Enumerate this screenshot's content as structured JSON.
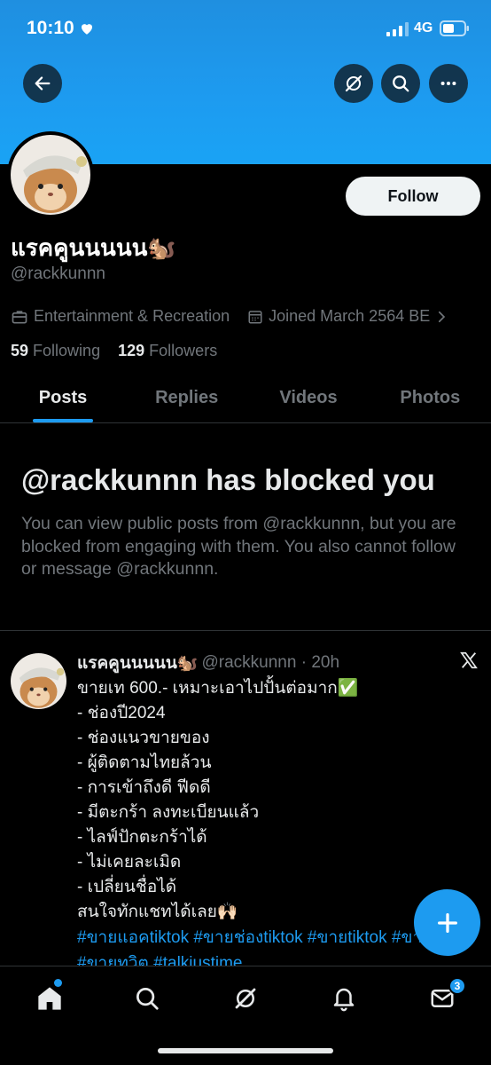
{
  "status": {
    "time": "10:10",
    "network": "4G"
  },
  "header": {
    "icons": [
      "back-arrow-icon",
      "grok-icon",
      "search-icon",
      "more-icon"
    ],
    "banner_color": "#1d9bf0"
  },
  "profile": {
    "display_name": "แรคคูนนนนน🐿️",
    "handle": "@rackkunnn",
    "follow_label": "Follow",
    "category": "Entertainment & Recreation",
    "joined": "Joined March 2564 BE",
    "following_count": "59",
    "following_label": "Following",
    "followers_count": "129",
    "followers_label": "Followers"
  },
  "tabs": [
    {
      "label": "Posts",
      "active": true
    },
    {
      "label": "Replies",
      "active": false
    },
    {
      "label": "Videos",
      "active": false
    },
    {
      "label": "Photos",
      "active": false
    }
  ],
  "blocked": {
    "title": "@rackkunnn has blocked you",
    "description": "You can view public posts from @rackkunnn, but you are blocked from engaging with them. You also cannot follow or message @rackkunnn."
  },
  "post": {
    "author": "แรคคูนนนนน🐿️",
    "handle_time": "@rackkunnn · 20h",
    "body": "ขายเท 600.- เหมาะเอาไปปั้นต่อมาก✅\n- ช่องปี2024\n- ช่องแนวขายของ\n- ผู้ติดตามไทยล้วน\n- การเข้าถึงดี ฟีดดี\n- มีตะกร้า ลงทะเบียนแล้ว\n-  ไลฟ์ปักตะกร้าได้\n- ไม่เคยละเมิด\n- เปลี่ยนชื่อได้\n สนใจทักแชทได้เลย🙌🏻",
    "tags": "#ขายแอคtiktok #ขายช่องtiktok #ขายtiktok #ขายไอจี #ขายทวิต #talkjustime"
  },
  "bottom_nav": {
    "items": [
      "home-icon",
      "explore-icon",
      "grok-icon",
      "notifications-icon",
      "messages-icon"
    ],
    "messages_badge": "3"
  },
  "colors": {
    "accent": "#1d9bf0",
    "background": "#000000",
    "muted": "#71767b"
  }
}
